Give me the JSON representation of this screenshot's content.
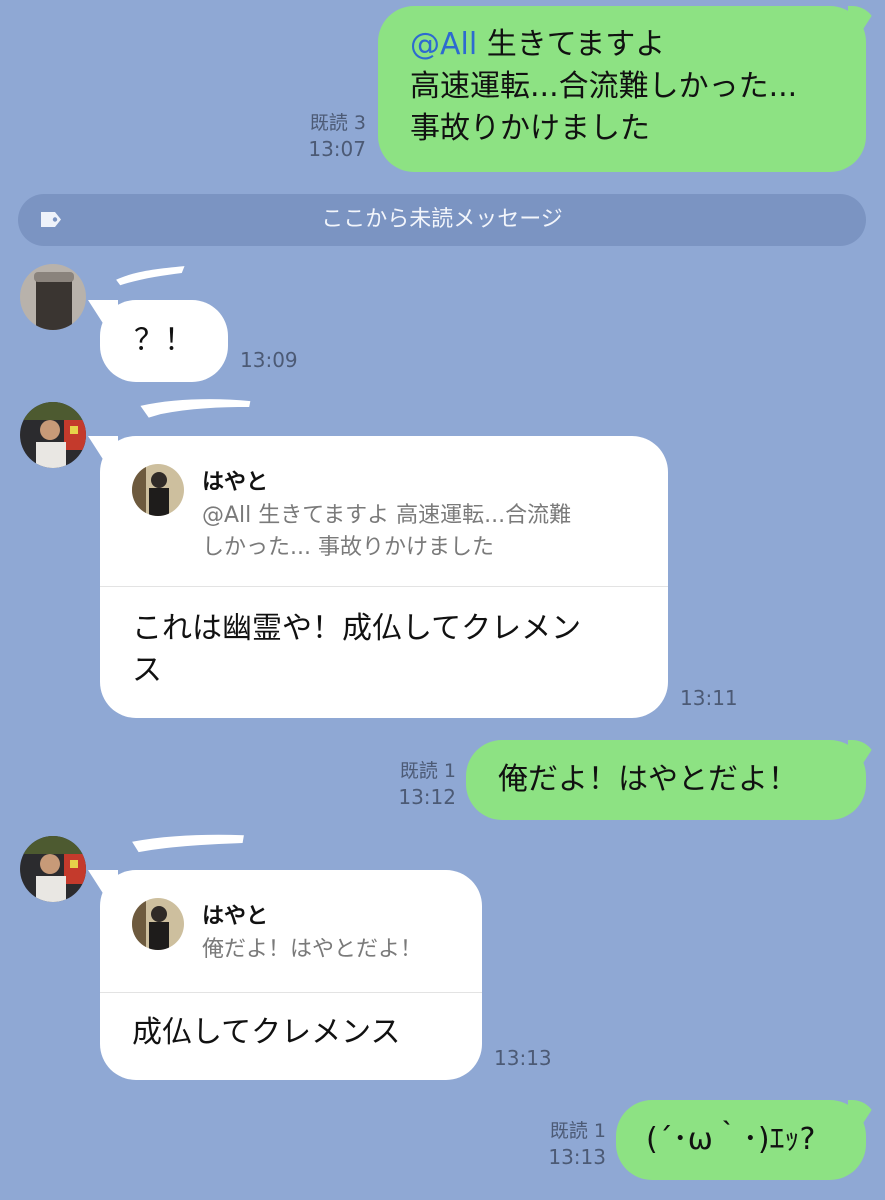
{
  "unread_divider": "ここから未読メッセージ",
  "messages": [
    {
      "id": "m1",
      "mention": "@All",
      "text_line1": " 生きてますよ",
      "text_rest": "高速運転...合流難しかった...\n事故りかけました",
      "read": "既読 3",
      "time": "13:07"
    },
    {
      "id": "m2",
      "text": "？！",
      "time": "13:09"
    },
    {
      "id": "m3",
      "reply_to_name": "はやと",
      "reply_to_text": "@All 生きてますよ 高速運転...合流難\nしかった... 事故りかけました",
      "text": "これは幽霊や！成仏してクレメン\nス",
      "time": "13:11"
    },
    {
      "id": "m4",
      "text": "俺だよ！はやとだよ！",
      "read": "既読 1",
      "time": "13:12"
    },
    {
      "id": "m5",
      "reply_to_name": "はやと",
      "reply_to_text": "俺だよ！はやとだよ！",
      "text": "成仏してクレメンス",
      "time": "13:13"
    },
    {
      "id": "m6",
      "text": "(´･ω｀･)ｴｯ?",
      "read": "既読 1",
      "time": "13:13"
    }
  ],
  "colors": {
    "background": "#8fa8d4",
    "my_bubble": "#8de283",
    "other_bubble": "#ffffff",
    "mention": "#2d6ad0",
    "unread_bar": "#7b94c2"
  },
  "icons": {
    "unread": "tag-icon"
  }
}
